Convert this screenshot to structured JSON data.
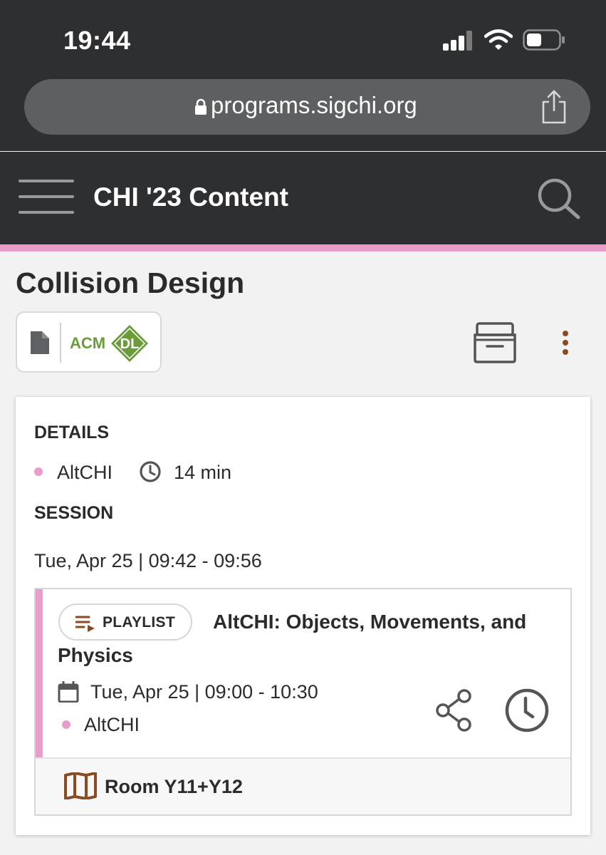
{
  "status_bar": {
    "time": "19:44"
  },
  "browser": {
    "url": "programs.sigchi.org"
  },
  "header": {
    "title": "CHI '23 Content"
  },
  "content": {
    "title": "Collision Design",
    "acm_dl": {
      "acm_label": "ACM",
      "dl_label": "DL"
    }
  },
  "details": {
    "heading": "DETAILS",
    "track": "AltCHI",
    "duration": "14 min",
    "session_heading": "SESSION",
    "session_time": "Tue, Apr 25 | 09:42 - 09:56"
  },
  "session": {
    "playlist_label": "PLAYLIST",
    "title_line1": "AltCHI: Objects, Movements, and",
    "title_line2": "Physics",
    "datetime": "Tue, Apr 25 | 09:00 - 10:30",
    "track": "AltCHI",
    "room": "Room Y11+Y12"
  },
  "colors": {
    "accent_pink": "#ea9ccb",
    "header_dark": "#2e2f31",
    "brown_icon": "#8a4a22",
    "acm_green": "#6a9d3a"
  },
  "icons": [
    "lock-icon",
    "share-icon",
    "hamburger-icon",
    "search-icon",
    "document-icon",
    "archive-icon",
    "more-vertical-icon",
    "clock-icon",
    "playlist-icon",
    "calendar-icon",
    "share-nodes-icon",
    "map-icon"
  ]
}
